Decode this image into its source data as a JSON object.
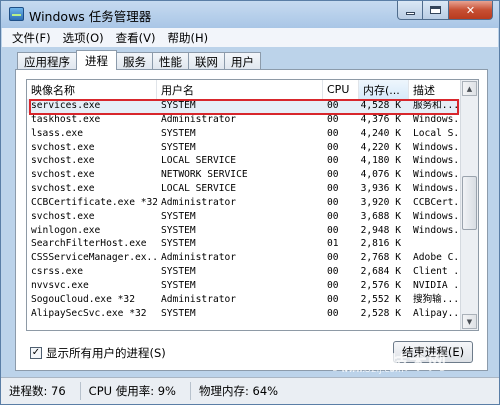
{
  "window": {
    "title": "Windows 任务管理器"
  },
  "menu": [
    "文件(F)",
    "选项(O)",
    "查看(V)",
    "帮助(H)"
  ],
  "tabs": [
    "应用程序",
    "进程",
    "服务",
    "性能",
    "联网",
    "用户"
  ],
  "active_tab": 1,
  "columns": [
    "映像名称",
    "用户名",
    "CPU",
    "内存(...",
    "描述"
  ],
  "processes": [
    [
      "services.exe",
      "SYSTEM",
      "00",
      "4,528 K",
      "服务和..."
    ],
    [
      "taskhost.exe",
      "Administrator",
      "00",
      "4,376 K",
      "Windows..."
    ],
    [
      "lsass.exe",
      "SYSTEM",
      "00",
      "4,240 K",
      "Local S..."
    ],
    [
      "svchost.exe",
      "SYSTEM",
      "00",
      "4,220 K",
      "Windows..."
    ],
    [
      "svchost.exe",
      "LOCAL SERVICE",
      "00",
      "4,180 K",
      "Windows..."
    ],
    [
      "svchost.exe",
      "NETWORK SERVICE",
      "00",
      "4,076 K",
      "Windows..."
    ],
    [
      "svchost.exe",
      "LOCAL SERVICE",
      "00",
      "3,936 K",
      "Windows..."
    ],
    [
      "CCBCertificate.exe *32",
      "Administrator",
      "00",
      "3,920 K",
      "CCBCert..."
    ],
    [
      "svchost.exe",
      "SYSTEM",
      "00",
      "3,688 K",
      "Windows..."
    ],
    [
      "winlogon.exe",
      "SYSTEM",
      "00",
      "2,948 K",
      "Windows..."
    ],
    [
      "SearchFilterHost.exe",
      "SYSTEM",
      "01",
      "2,816 K",
      ""
    ],
    [
      "CSSServiceManager.ex...",
      "Administrator",
      "00",
      "2,768 K",
      "Adobe C..."
    ],
    [
      "csrss.exe",
      "SYSTEM",
      "00",
      "2,684 K",
      "Client ..."
    ],
    [
      "nvvsvc.exe",
      "SYSTEM",
      "00",
      "2,576 K",
      "NVIDIA ..."
    ],
    [
      "SogouCloud.exe *32",
      "Administrator",
      "00",
      "2,552 K",
      "搜狗输..."
    ],
    [
      "AlipaySecSvc.exe *32",
      "SYSTEM",
      "00",
      "2,528 K",
      "Alipay..."
    ]
  ],
  "selected_row": 0,
  "show_all_users": {
    "checked": true,
    "label": "显示所有用户的进程(S)",
    "mark": "✓"
  },
  "end_process_label": "结束进程(E)",
  "status": {
    "processes": "进程数: 76",
    "cpu": "CPU 使用率: 9%",
    "memory": "物理内存: 64%"
  },
  "watermark": {
    "text": "我爱IT技术网",
    "url": "www.52ij.com"
  },
  "icons": {
    "minimize": "minimize-icon",
    "maximize": "maximize-icon",
    "close": "close-icon"
  },
  "colors": {
    "highlight": "#d8262c",
    "titlebar": "#bcd3ea"
  }
}
